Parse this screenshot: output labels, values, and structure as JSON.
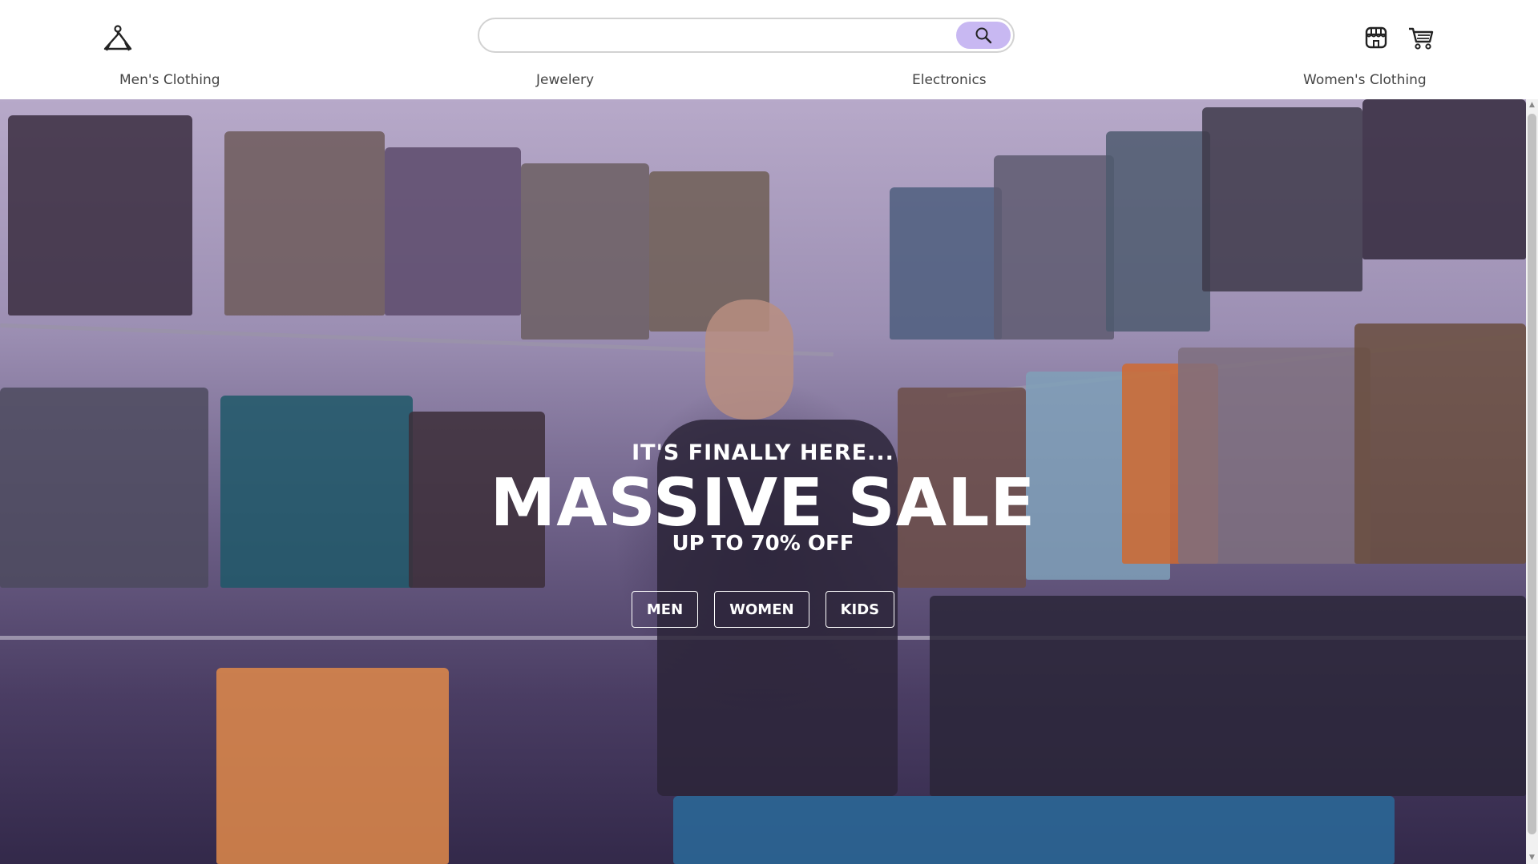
{
  "header": {
    "logo_icon": "hanger-icon",
    "search": {
      "placeholder": "",
      "value": "",
      "button_icon": "search-icon",
      "button_color": "#c8b8f2"
    },
    "store_icon": "store-icon",
    "cart_icon": "cart-icon"
  },
  "nav": {
    "items": [
      "Men's Clothing",
      "Jewelery",
      "Electronics",
      "Women's Clothing"
    ]
  },
  "hero": {
    "kicker": "IT'S FINALLY HERE...",
    "title": "MASSIVE SALE",
    "subtitle": "UP TO 70% OFF",
    "buttons": [
      "MEN",
      "WOMEN",
      "KIDS"
    ],
    "overlay_color": "#6e6188"
  }
}
